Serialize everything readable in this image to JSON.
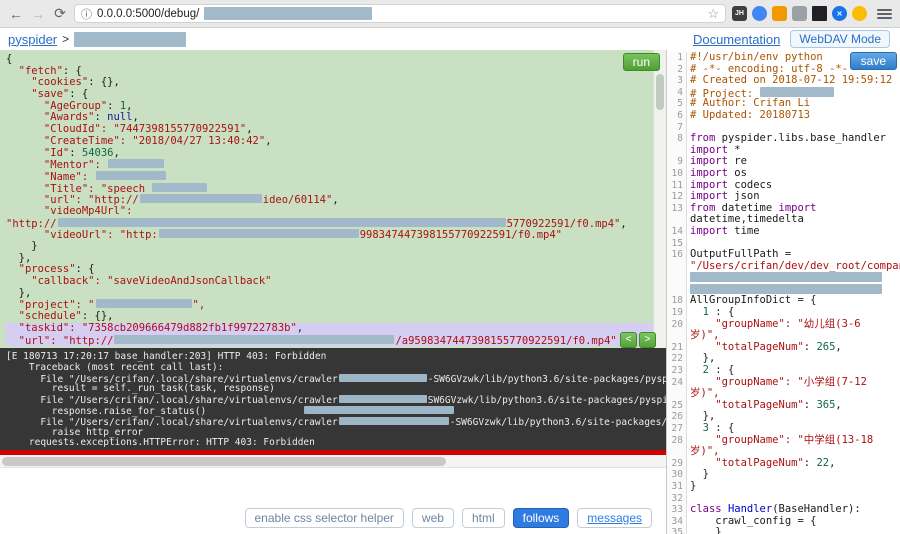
{
  "colors": {
    "accent_blue": "#2e7ce0",
    "link_blue": "#2a6fc9",
    "run_green": "#4f9f33",
    "panel_green": "#c9e0c3",
    "console_bg": "#363636",
    "error_red": "#cf0000",
    "redact_gray_blue": "#a2b9c9",
    "highlight_lavender": "#d6cdf2"
  },
  "browser": {
    "url": "0.0.0.0:5000/debug/",
    "nav": {
      "back": "←",
      "forward": "→",
      "reload": "⟳",
      "info": "ⓘ",
      "star": "☆"
    },
    "extensions": [
      {
        "name": "jh-extension-icon",
        "label": "JH",
        "bg": "#3c4043",
        "shape": "round-square"
      },
      {
        "name": "blue-extension-icon",
        "label": "",
        "bg": "#4285f4",
        "shape": "circle"
      },
      {
        "name": "orange-extension-icon",
        "label": "",
        "bg": "#f29900",
        "shape": "round-square"
      },
      {
        "name": "gray-extension-icon",
        "label": "",
        "bg": "#9aa0a6",
        "shape": "round-square"
      },
      {
        "name": "qr-extension-icon",
        "label": "",
        "bg": "#202124",
        "shape": "square"
      },
      {
        "name": "x-extension-icon",
        "label": "✕",
        "bg": "#1a73e8",
        "shape": "circle"
      },
      {
        "name": "yellow-extension-icon",
        "label": "",
        "bg": "#fbbc04",
        "shape": "circle"
      }
    ]
  },
  "app_bar": {
    "brand": "pyspider",
    "separator": ">",
    "documentation_label": "Documentation",
    "webdav_label": "WebDAV Mode"
  },
  "task_panel": {
    "run_label": "run",
    "collapse_left": "<",
    "collapse_right": ">",
    "rows": [
      {
        "s": [
          {
            "c": "p",
            "t": "{"
          }
        ]
      },
      {
        "s": [
          {
            "c": "s",
            "t": "  \"fetch\""
          },
          {
            "c": "p",
            "t": ": {"
          }
        ]
      },
      {
        "s": [
          {
            "c": "s",
            "t": "    \"cookies\""
          },
          {
            "c": "p",
            "t": ": {},"
          }
        ]
      },
      {
        "s": [
          {
            "c": "s",
            "t": "    \"save\""
          },
          {
            "c": "p",
            "t": ": {"
          }
        ]
      },
      {
        "s": [
          {
            "c": "s",
            "t": "      \"AgeGroup\""
          },
          {
            "c": "p",
            "t": ": "
          },
          {
            "c": "n",
            "t": "1"
          },
          {
            "c": "p",
            "t": ","
          }
        ]
      },
      {
        "s": [
          {
            "c": "s",
            "t": "      \"Awards\""
          },
          {
            "c": "p",
            "t": ": "
          },
          {
            "c": "a",
            "t": "null"
          },
          {
            "c": "p",
            "t": ","
          }
        ]
      },
      {
        "s": [
          {
            "c": "s",
            "t": "      \"CloudId\": \"7447398155770922591\""
          },
          {
            "c": "p",
            "t": ","
          }
        ]
      },
      {
        "s": [
          {
            "c": "s",
            "t": "      \"CreateTime\": \"2018/04/27 13:40:42\""
          },
          {
            "c": "p",
            "t": ","
          }
        ]
      },
      {
        "s": [
          {
            "c": "s",
            "t": "      \"Id\""
          },
          {
            "c": "p",
            "t": ": "
          },
          {
            "c": "n",
            "t": "54036"
          },
          {
            "c": "p",
            "t": ","
          }
        ]
      },
      {
        "s": [
          {
            "c": "s",
            "t": "      \"Mentor\": "
          },
          {
            "r": 56
          }
        ]
      },
      {
        "s": [
          {
            "c": "s",
            "t": "      \"Name\": "
          },
          {
            "r": 70
          }
        ]
      },
      {
        "s": [
          {
            "c": "s",
            "t": "      \"Title\": \"speech "
          },
          {
            "r": 55
          }
        ]
      },
      {
        "s": [
          {
            "c": "s",
            "t": "      \"url\": \"http://"
          },
          {
            "r": 122
          },
          {
            "c": "s",
            "t": "ideo/60114\""
          },
          {
            "c": "p",
            "t": ","
          }
        ]
      },
      {
        "s": [
          {
            "c": "s",
            "t": "      \"videoMp4Url\":"
          }
        ]
      },
      {
        "s": [
          {
            "c": "s",
            "t": "\"http://"
          },
          {
            "r": 448
          },
          {
            "c": "s",
            "t": "5770922591/f0.mp4\""
          },
          {
            "c": "p",
            "t": ","
          }
        ]
      },
      {
        "s": [
          {
            "c": "s",
            "t": "      \"videoUrl\": \"http:"
          },
          {
            "r": 200
          },
          {
            "c": "s",
            "t": "998347447398155770922591/f0.mp4\""
          }
        ]
      },
      {
        "s": [
          {
            "c": "p",
            "t": "    }"
          }
        ]
      },
      {
        "s": [
          {
            "c": "p",
            "t": "  },"
          }
        ]
      },
      {
        "s": [
          {
            "c": "s",
            "t": "  \"process\""
          },
          {
            "c": "p",
            "t": ": {"
          }
        ]
      },
      {
        "s": [
          {
            "c": "s",
            "t": "    \"callback\": \"saveVideoAndJsonCallback\""
          }
        ]
      },
      {
        "s": [
          {
            "c": "p",
            "t": "  },"
          }
        ]
      },
      {
        "s": [
          {
            "c": "s",
            "t": "  \"project\": \""
          },
          {
            "r": 96
          },
          {
            "c": "s",
            "t": "\","
          }
        ]
      },
      {
        "s": [
          {
            "c": "s",
            "t": "  \"schedule\""
          },
          {
            "c": "p",
            "t": ": {},"
          }
        ]
      },
      {
        "h": true,
        "s": [
          {
            "c": "s",
            "t": "  \"taskid\": \"7358cb209666479d882fb1f99722783b\""
          },
          {
            "c": "p",
            "t": ","
          }
        ]
      },
      {
        "h": true,
        "s": [
          {
            "c": "s",
            "t": "  \"url\": \"http://"
          },
          {
            "r": 280
          },
          {
            "c": "s",
            "t": "/a9598347447398155770922591/f0.mp4\""
          }
        ]
      }
    ]
  },
  "console": {
    "rows": [
      {
        "s": [
          {
            "c": "t",
            "t": "[E 180713 17:20:17 base_handler:203] HTTP 403: Forbidden"
          }
        ]
      },
      {
        "s": [
          {
            "c": "t",
            "t": "    Traceback (most recent call last):"
          }
        ]
      },
      {
        "s": [
          {
            "c": "t",
            "t": "      File \"/Users/crifan/.local/share/virtualenvs/crawler"
          },
          {
            "r": 88
          },
          {
            "c": "t",
            "t": "-SW6GVzwk/lib/python3.6/site-packages/pyspi"
          }
        ]
      },
      {
        "s": [
          {
            "c": "t",
            "t": "        result = self._run_task(task, response)"
          }
        ]
      },
      {
        "s": [
          {
            "c": "t",
            "t": "      File \"/Users/crifan/.local/share/virtualenvs/crawler"
          },
          {
            "r": 88
          },
          {
            "c": "t",
            "t": "SW6GVzwk/lib/python3.6/site-packages/pyspi"
          }
        ]
      },
      {
        "s": [
          {
            "c": "t",
            "t": "        response.raise_for_status()"
          },
          {
            "c": "t",
            "t": "                 "
          },
          {
            "r": 150
          }
        ]
      },
      {
        "s": [
          {
            "c": "t",
            "t": "      File \"/Users/crifan/.local/share/virtualenvs/crawler"
          },
          {
            "r": 110
          },
          {
            "c": "t",
            "t": "-SW6GVzwk/lib/python3.6/site-packages/pyspi"
          }
        ]
      },
      {
        "s": [
          {
            "c": "t",
            "t": "        raise http_error"
          }
        ]
      },
      {
        "s": [
          {
            "c": "t",
            "t": "    requests.exceptions.HTTPError: HTTP 403: Forbidden"
          }
        ]
      }
    ]
  },
  "code_panel": {
    "save_label": "save",
    "rows": [
      {
        "n": "1",
        "s": [
          {
            "c": "c",
            "t": "#!/usr/bin/env python"
          }
        ]
      },
      {
        "n": "2",
        "s": [
          {
            "c": "c",
            "t": "# -*- encoding: utf-8 -*-"
          }
        ]
      },
      {
        "n": "3",
        "s": [
          {
            "c": "c",
            "t": "# Created on 2018-07-12 19:59:12"
          }
        ]
      },
      {
        "n": "4",
        "s": [
          {
            "c": "c",
            "t": "# Project: "
          },
          {
            "r": 74
          }
        ]
      },
      {
        "n": "5",
        "s": [
          {
            "c": "c",
            "t": "# Author: Crifan Li"
          }
        ]
      },
      {
        "n": "6",
        "s": [
          {
            "c": "c",
            "t": "# Updated: 20180713"
          }
        ]
      },
      {
        "n": "7",
        "s": []
      },
      {
        "n": "8",
        "s": [
          {
            "c": "k",
            "t": "from"
          },
          {
            "c": "p",
            "t": " pyspider.libs.base_handler"
          }
        ]
      },
      {
        "n": "",
        "s": [
          {
            "c": "k",
            "t": "import"
          },
          {
            "c": "p",
            "t": " *"
          }
        ]
      },
      {
        "n": "9",
        "s": [
          {
            "c": "k",
            "t": "import"
          },
          {
            "c": "p",
            "t": " re"
          }
        ]
      },
      {
        "n": "10",
        "s": [
          {
            "c": "k",
            "t": "import"
          },
          {
            "c": "p",
            "t": " os"
          }
        ]
      },
      {
        "n": "11",
        "s": [
          {
            "c": "k",
            "t": "import"
          },
          {
            "c": "p",
            "t": " codecs"
          }
        ]
      },
      {
        "n": "12",
        "s": [
          {
            "c": "k",
            "t": "import"
          },
          {
            "c": "p",
            "t": " json"
          }
        ]
      },
      {
        "n": "13",
        "s": [
          {
            "c": "k",
            "t": "from"
          },
          {
            "c": "p",
            "t": " datetime "
          },
          {
            "c": "k",
            "t": "import"
          }
        ]
      },
      {
        "n": "",
        "s": [
          {
            "c": "p",
            "t": "datetime,timedelta"
          }
        ]
      },
      {
        "n": "14",
        "s": [
          {
            "c": "k",
            "t": "import"
          },
          {
            "c": "p",
            "t": " time"
          }
        ]
      },
      {
        "n": "15",
        "s": []
      },
      {
        "n": "16",
        "s": [
          {
            "c": "p",
            "t": "OutputFullPath ="
          }
        ]
      },
      {
        "n": "",
        "s": [
          {
            "c": "s",
            "t": "\"/Users/crifan/dev/dev_root/compan"
          }
        ]
      },
      {
        "n": "",
        "s": [
          {
            "r": 192
          }
        ]
      },
      {
        "n": "",
        "s": [
          {
            "r": 192
          }
        ]
      },
      {
        "n": "18",
        "s": [
          {
            "c": "p",
            "t": "AllGroupInfoDict = {"
          }
        ]
      },
      {
        "n": "19",
        "s": [
          {
            "c": "p",
            "t": "  "
          },
          {
            "c": "n",
            "t": "1"
          },
          {
            "c": "p",
            "t": " : {"
          }
        ]
      },
      {
        "n": "20",
        "s": [
          {
            "c": "s",
            "t": "    \"groupName\": \"幼儿组(3-6"
          }
        ]
      },
      {
        "n": "",
        "s": [
          {
            "c": "s",
            "t": "岁)\","
          }
        ]
      },
      {
        "n": "21",
        "s": [
          {
            "c": "s",
            "t": "    \"totalPageNum\""
          },
          {
            "c": "p",
            "t": ": "
          },
          {
            "c": "n",
            "t": "265"
          },
          {
            "c": "p",
            "t": ","
          }
        ]
      },
      {
        "n": "22",
        "s": [
          {
            "c": "p",
            "t": "  },"
          }
        ]
      },
      {
        "n": "23",
        "s": [
          {
            "c": "p",
            "t": "  "
          },
          {
            "c": "n",
            "t": "2"
          },
          {
            "c": "p",
            "t": " : {"
          }
        ]
      },
      {
        "n": "24",
        "s": [
          {
            "c": "s",
            "t": "    \"groupName\": \"小学组(7-12"
          }
        ]
      },
      {
        "n": "",
        "s": [
          {
            "c": "s",
            "t": "岁)\","
          }
        ]
      },
      {
        "n": "25",
        "s": [
          {
            "c": "s",
            "t": "    \"totalPageNum\""
          },
          {
            "c": "p",
            "t": ": "
          },
          {
            "c": "n",
            "t": "365"
          },
          {
            "c": "p",
            "t": ","
          }
        ]
      },
      {
        "n": "26",
        "s": [
          {
            "c": "p",
            "t": "  },"
          }
        ]
      },
      {
        "n": "27",
        "s": [
          {
            "c": "p",
            "t": "  "
          },
          {
            "c": "n",
            "t": "3"
          },
          {
            "c": "p",
            "t": " : {"
          }
        ]
      },
      {
        "n": "28",
        "s": [
          {
            "c": "s",
            "t": "    \"groupName\": \"中学组(13-18"
          }
        ]
      },
      {
        "n": "",
        "s": [
          {
            "c": "s",
            "t": "岁)\","
          }
        ]
      },
      {
        "n": "29",
        "s": [
          {
            "c": "s",
            "t": "    \"totalPageNum\""
          },
          {
            "c": "p",
            "t": ": "
          },
          {
            "c": "n",
            "t": "22"
          },
          {
            "c": "p",
            "t": ","
          }
        ]
      },
      {
        "n": "30",
        "s": [
          {
            "c": "p",
            "t": "  }"
          }
        ]
      },
      {
        "n": "31",
        "s": [
          {
            "c": "p",
            "t": "}"
          }
        ]
      },
      {
        "n": "32",
        "s": []
      },
      {
        "n": "33",
        "s": [
          {
            "c": "k",
            "t": "class"
          },
          {
            "c": "p",
            "t": " "
          },
          {
            "c": "d",
            "t": "Handler"
          },
          {
            "c": "p",
            "t": "(BaseHandler):"
          }
        ]
      },
      {
        "n": "34",
        "s": [
          {
            "c": "p",
            "t": "    crawl_config = {"
          }
        ]
      },
      {
        "n": "35",
        "s": [
          {
            "c": "p",
            "t": "    }"
          }
        ]
      }
    ]
  },
  "footer": {
    "buttons": [
      {
        "name": "css-selector-helper-button",
        "label": "enable css selector helper",
        "variant": "default"
      },
      {
        "name": "web-button",
        "label": "web",
        "variant": "default"
      },
      {
        "name": "html-button",
        "label": "html",
        "variant": "default"
      },
      {
        "name": "follows-button",
        "label": "follows",
        "variant": "primary"
      },
      {
        "name": "messages-button",
        "label": "messages",
        "variant": "link"
      }
    ]
  }
}
